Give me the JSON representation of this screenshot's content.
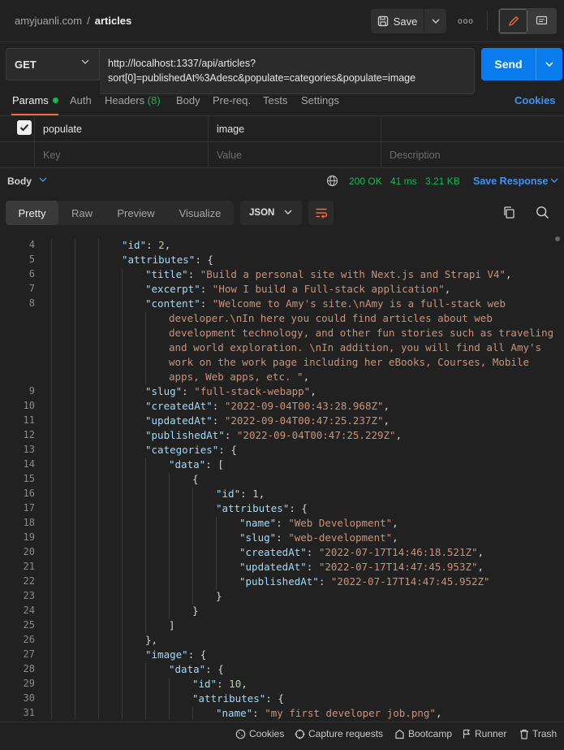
{
  "breadcrumb": {
    "workspace": "amyjuanli.com",
    "separator": "/",
    "current": "articles"
  },
  "toolbar": {
    "save_label": "Save",
    "more_label": "ooo"
  },
  "request": {
    "method": "GET",
    "url_line1": "http://localhost:1337/api/articles?",
    "url_line2": "sort[0]=publishedAt%3Adesc&populate=categories&populate=image",
    "send_label": "Send"
  },
  "request_tabs": {
    "params": "Params",
    "auth": "Auth",
    "headers": "Headers",
    "headers_count": "(8)",
    "body": "Body",
    "prereq": "Pre-req.",
    "tests": "Tests",
    "settings": "Settings",
    "cookies": "Cookies"
  },
  "params_table": {
    "row": {
      "key": "populate",
      "value": "image",
      "description": ""
    },
    "placeholders": {
      "key": "Key",
      "value": "Value",
      "description": "Description"
    }
  },
  "response": {
    "body_label": "Body",
    "status": "200 OK",
    "time": "41 ms",
    "size": "3.21 KB",
    "save_response": "Save Response",
    "view_tabs": [
      "Pretty",
      "Raw",
      "Preview",
      "Visualize"
    ],
    "format": "JSON"
  },
  "code_lines": [
    {
      "n": "4",
      "indent": 3,
      "html": "<span class=\"k\">\"id\"</span>: <span class=\"n\">2</span>,"
    },
    {
      "n": "5",
      "indent": 3,
      "html": "<span class=\"k\">\"attributes\"</span>: {"
    },
    {
      "n": "6",
      "indent": 4,
      "html": "<span class=\"k\">\"title\"</span>: <span class=\"s\">\"Build a personal site with Next.js and Strapi V4\"</span>,"
    },
    {
      "n": "7",
      "indent": 4,
      "html": "<span class=\"k\">\"excerpt\"</span>: <span class=\"s\">\"How I build a Full-stack application\"</span>,"
    },
    {
      "n": "8",
      "indent": 4,
      "html": "<span class=\"k\">\"content\"</span>: <span class=\"s\">\"Welcome to Amy's site.\\nAmy is a full-stack web</span>"
    },
    {
      "n": "",
      "indent": 5,
      "html": "<span class=\"s\">developer.\\nIn here you could find articles about web</span>"
    },
    {
      "n": "",
      "indent": 5,
      "html": "<span class=\"s\">development technology, and other fun stories such as traveling</span>"
    },
    {
      "n": "",
      "indent": 5,
      "html": "<span class=\"s\">and world exploration. \\nIn addition, you will find all Amy's</span>"
    },
    {
      "n": "",
      "indent": 5,
      "html": "<span class=\"s\">work on the work page including her eBooks, Courses, Mobile</span>"
    },
    {
      "n": "",
      "indent": 5,
      "html": "<span class=\"s\">apps, Web apps, etc. \"</span>,"
    },
    {
      "n": "9",
      "indent": 4,
      "html": "<span class=\"k\">\"slug\"</span>: <span class=\"s\">\"full-stack-webapp\"</span>,"
    },
    {
      "n": "10",
      "indent": 4,
      "html": "<span class=\"k\">\"createdAt\"</span>: <span class=\"s\">\"2022-09-04T00:43:28.968Z\"</span>,"
    },
    {
      "n": "11",
      "indent": 4,
      "html": "<span class=\"k\">\"updatedAt\"</span>: <span class=\"s\">\"2022-09-04T00:47:25.237Z\"</span>,"
    },
    {
      "n": "12",
      "indent": 4,
      "html": "<span class=\"k\">\"publishedAt\"</span>: <span class=\"s\">\"2022-09-04T00:47:25.229Z\"</span>,"
    },
    {
      "n": "13",
      "indent": 4,
      "html": "<span class=\"k\">\"categories\"</span>: {"
    },
    {
      "n": "14",
      "indent": 5,
      "html": "<span class=\"k\">\"data\"</span>: ["
    },
    {
      "n": "15",
      "indent": 6,
      "html": "{"
    },
    {
      "n": "16",
      "indent": 7,
      "html": "<span class=\"k\">\"id\"</span>: <span class=\"n\">1</span>,"
    },
    {
      "n": "17",
      "indent": 7,
      "html": "<span class=\"k\">\"attributes\"</span>: {"
    },
    {
      "n": "18",
      "indent": 8,
      "html": "<span class=\"k\">\"name\"</span>: <span class=\"s\">\"Web Development\"</span>,"
    },
    {
      "n": "19",
      "indent": 8,
      "html": "<span class=\"k\">\"slug\"</span>: <span class=\"s\">\"web-development\"</span>,"
    },
    {
      "n": "20",
      "indent": 8,
      "html": "<span class=\"k\">\"createdAt\"</span>: <span class=\"s\">\"2022-07-17T14:46:18.521Z\"</span>,"
    },
    {
      "n": "21",
      "indent": 8,
      "html": "<span class=\"k\">\"updatedAt\"</span>: <span class=\"s\">\"2022-07-17T14:47:45.953Z\"</span>,"
    },
    {
      "n": "22",
      "indent": 8,
      "html": "<span class=\"k\">\"publishedAt\"</span>: <span class=\"s\">\"2022-07-17T14:47:45.952Z\"</span>"
    },
    {
      "n": "23",
      "indent": 7,
      "html": "}"
    },
    {
      "n": "24",
      "indent": 6,
      "html": "}"
    },
    {
      "n": "25",
      "indent": 5,
      "html": "]"
    },
    {
      "n": "26",
      "indent": 4,
      "html": "},"
    },
    {
      "n": "27",
      "indent": 4,
      "html": "<span class=\"k\">\"image\"</span>: {"
    },
    {
      "n": "28",
      "indent": 5,
      "html": "<span class=\"k\">\"data\"</span>: {"
    },
    {
      "n": "29",
      "indent": 6,
      "html": "<span class=\"k\">\"id\"</span>: <span class=\"n\">10</span>,"
    },
    {
      "n": "30",
      "indent": 6,
      "html": "<span class=\"k\">\"attributes\"</span>: {"
    },
    {
      "n": "31",
      "indent": 7,
      "html": "<span class=\"k\">\"name\"</span>: <span class=\"s\">\"my first developer job.png\"</span>,"
    }
  ],
  "footer": {
    "cookies": "Cookies",
    "capture": "Capture requests",
    "bootcamp": "Bootcamp",
    "runner": "Runner",
    "trash": "Trash"
  },
  "colors": {
    "accent": "#097bed",
    "success": "#0cbb52",
    "active_tab": "#f26b3a",
    "link": "#3d94f6"
  }
}
